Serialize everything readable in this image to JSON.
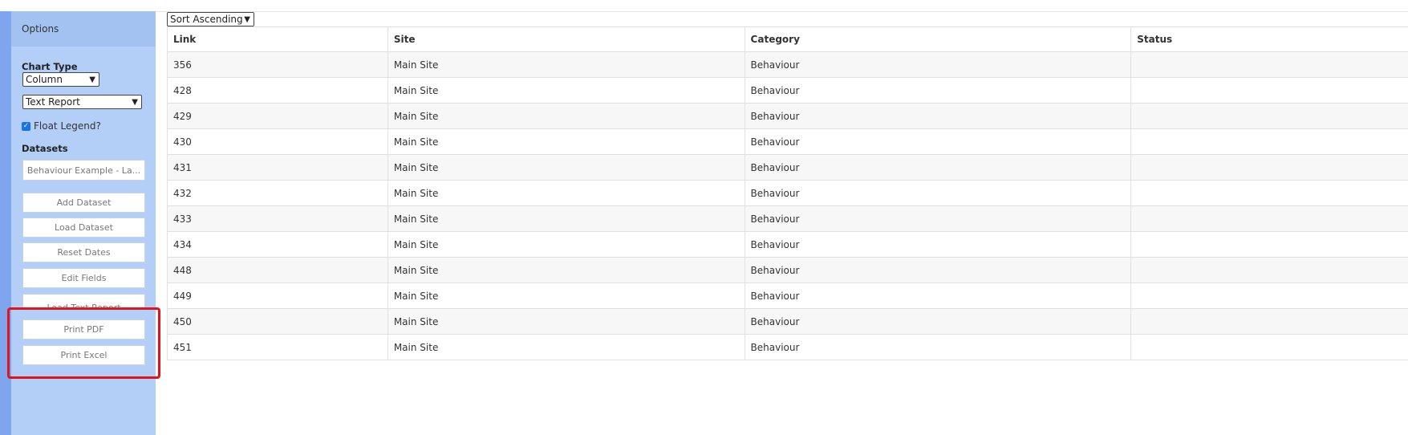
{
  "sidebar": {
    "title": "Options",
    "chart_type_label": "Chart Type",
    "chart_type_value": "Column",
    "report_value": "Text Report",
    "float_legend_label": "Float Legend?",
    "datasets_label": "Datasets",
    "dataset_button": "Behaviour Example - La...",
    "buttons": {
      "add_dataset": "Add Dataset",
      "load_dataset": "Load Dataset",
      "reset_dates": "Reset Dates",
      "edit_fields": "Edit Fields",
      "load_text_report": "Load Text Report",
      "print_pdf": "Print PDF",
      "print_excel": "Print Excel"
    }
  },
  "sort": {
    "value": "Sort Ascending"
  },
  "table": {
    "columns": [
      "Link",
      "Site",
      "Category",
      "Status"
    ],
    "rows": [
      [
        "356",
        "Main Site",
        "Behaviour",
        ""
      ],
      [
        "428",
        "Main Site",
        "Behaviour",
        ""
      ],
      [
        "429",
        "Main Site",
        "Behaviour",
        ""
      ],
      [
        "430",
        "Main Site",
        "Behaviour",
        ""
      ],
      [
        "431",
        "Main Site",
        "Behaviour",
        ""
      ],
      [
        "432",
        "Main Site",
        "Behaviour",
        ""
      ],
      [
        "433",
        "Main Site",
        "Behaviour",
        ""
      ],
      [
        "434",
        "Main Site",
        "Behaviour",
        ""
      ],
      [
        "448",
        "Main Site",
        "Behaviour",
        ""
      ],
      [
        "449",
        "Main Site",
        "Behaviour",
        ""
      ],
      [
        "450",
        "Main Site",
        "Behaviour",
        ""
      ],
      [
        "451",
        "Main Site",
        "Behaviour",
        ""
      ]
    ]
  },
  "colors": {
    "sidebar": "#b4cff7",
    "sidebar_header": "#a3c2f2",
    "highlight": "#e0141c"
  }
}
